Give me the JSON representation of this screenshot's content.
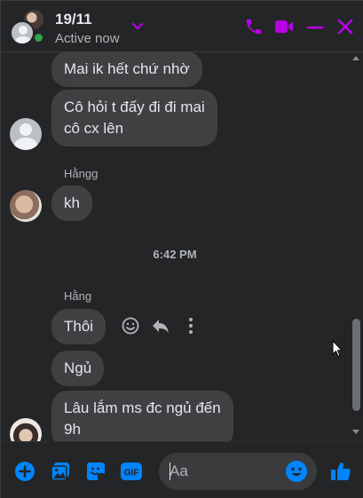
{
  "header": {
    "title": "19/11",
    "status": "Active now"
  },
  "colors": {
    "accent": "#b800e6",
    "messenger_blue": "#0084ff",
    "bubble": "#3e4042",
    "background": "#242526",
    "online": "#31a24c"
  },
  "messages": [
    {
      "text": "Mai ik hết chứ nhờ"
    },
    {
      "text": "Cô hỏi t đấy đi đi mai\ncô cx lên"
    },
    {
      "sender": "Hằngg",
      "text": "kh"
    },
    {
      "time": "6:42 PM"
    },
    {
      "sender": "Hằng",
      "text": "Thôi"
    },
    {
      "text": "Ngủ"
    },
    {
      "text": "Lâu lắm ms đc ngủ đến\n9h"
    }
  ],
  "composer": {
    "placeholder": "Aa"
  },
  "icons": {
    "header": [
      "phone-icon",
      "video-icon",
      "minimize-icon",
      "close-icon"
    ],
    "composer": [
      "plus-icon",
      "photo-icon",
      "sticker-icon",
      "gif-icon",
      "emoji-icon",
      "like-icon"
    ],
    "message_actions": [
      "react-icon",
      "reply-icon",
      "more-icon"
    ]
  }
}
